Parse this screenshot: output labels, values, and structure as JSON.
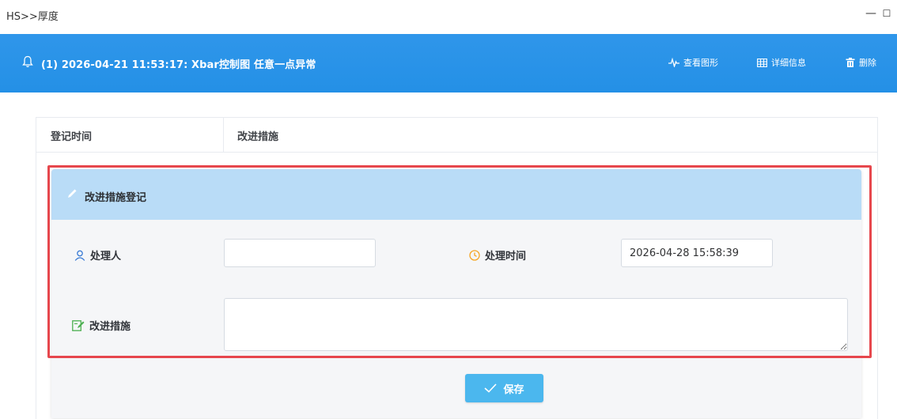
{
  "window": {
    "title": "HS>>厚度",
    "minimize_glyph": "—",
    "maximize_glyph": "☐"
  },
  "alarm": {
    "icon": "bell-icon",
    "text": "(1) 2026-04-21 11:53:17:  Xbar控制图 任意一点异常",
    "actions": [
      {
        "icon": "chart-icon",
        "label": "查看图形"
      },
      {
        "icon": "table-icon",
        "label": "详细信息"
      },
      {
        "icon": "trash-icon",
        "label": "删除"
      }
    ]
  },
  "table": {
    "columns": [
      "登记时间",
      "改进措施"
    ]
  },
  "form": {
    "title": "改进措施登记",
    "handler_label": "处理人",
    "handler_value": "",
    "time_label": "处理时间",
    "time_value": "2026-04-28 15:58:39",
    "measure_label": "改进措施",
    "measure_value": "",
    "save_label": "保存"
  },
  "colors": {
    "banner_blue": "#2792e7",
    "panel_header": "#b9dcf7",
    "save_button": "#4bb7ee",
    "highlight_border": "#e6474d",
    "icon_blue": "#3a7bd5",
    "icon_orange": "#f5a623",
    "icon_green": "#4caf50"
  }
}
